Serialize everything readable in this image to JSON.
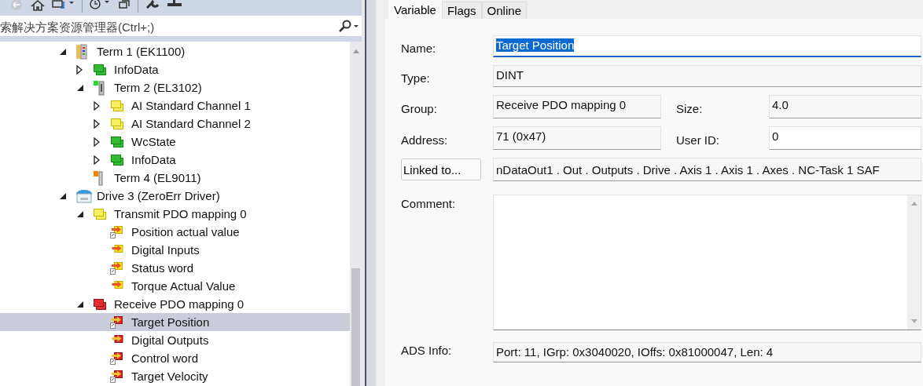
{
  "toolbar": {
    "search": {
      "placeholder": "索解决方案资源管理器(Ctrl+;)"
    }
  },
  "tree": [
    {
      "label": "Term 1 (EK1100)",
      "kind": "coupler",
      "expanded": true,
      "selected": false,
      "children": [
        {
          "label": "InfoData",
          "kind": "green-group",
          "expanded": false,
          "selected": false
        },
        {
          "label": "Term 2 (EL3102)",
          "kind": "terminal",
          "expanded": true,
          "selected": false,
          "children": [
            {
              "label": "AI Standard Channel 1",
              "kind": "yellow-group",
              "expanded": false,
              "selected": false
            },
            {
              "label": "AI Standard Channel 2",
              "kind": "yellow-group",
              "expanded": false,
              "selected": false
            },
            {
              "label": "WcState",
              "kind": "green-group",
              "expanded": false,
              "selected": false
            },
            {
              "label": "InfoData",
              "kind": "green-group",
              "expanded": false,
              "selected": false
            }
          ]
        },
        {
          "label": "Term 4 (EL9011)",
          "kind": "end-terminal",
          "selected": false
        }
      ]
    },
    {
      "label": "Drive 3 (ZeroErr Driver)",
      "kind": "drive",
      "expanded": true,
      "selected": false,
      "children": [
        {
          "label": "Transmit PDO mapping 0",
          "kind": "yellow-group",
          "expanded": true,
          "selected": false,
          "children": [
            {
              "label": "Position actual value",
              "kind": "input-var",
              "linked": true,
              "selected": false
            },
            {
              "label": "Digital Inputs",
              "kind": "input-var",
              "linked": false,
              "selected": false
            },
            {
              "label": "Status word",
              "kind": "input-var",
              "linked": true,
              "selected": false
            },
            {
              "label": "Torque Actual Value",
              "kind": "input-var",
              "linked": false,
              "selected": false
            }
          ]
        },
        {
          "label": "Receive PDO mapping 0",
          "kind": "red-group",
          "expanded": true,
          "selected": false,
          "children": [
            {
              "label": "Target Position",
              "kind": "output-var",
              "linked": true,
              "selected": true
            },
            {
              "label": "Digital Outputs",
              "kind": "output-var",
              "linked": false,
              "selected": false
            },
            {
              "label": "Control word",
              "kind": "output-var",
              "linked": true,
              "selected": false
            },
            {
              "label": "Target Velocity",
              "kind": "output-var",
              "linked": true,
              "selected": false
            }
          ]
        }
      ]
    }
  ],
  "tabs": [
    {
      "label": "Variable",
      "selected": true
    },
    {
      "label": "Flags",
      "selected": false
    },
    {
      "label": "Online",
      "selected": false
    }
  ],
  "form": {
    "name": {
      "label": "Name:",
      "value": "Target Position",
      "text_selected": true
    },
    "type": {
      "label": "Type:",
      "value": "DINT"
    },
    "group": {
      "label": "Group:",
      "value": "Receive PDO mapping 0"
    },
    "size": {
      "label": "Size:",
      "value": "4.0"
    },
    "address": {
      "label": "Address:",
      "value": "71 (0x47)"
    },
    "user_id": {
      "label": "User ID:",
      "value": "0"
    },
    "linked_button": "Linked to...",
    "linked_value": "nDataOut1 . Out . Outputs . Drive . Axis 1 . Axis 1 . Axes . NC-Task 1 SAF",
    "comment": {
      "label": "Comment:"
    },
    "ads_info": {
      "label": "ADS Info:",
      "value": "Port: 11, IGrp: 0x3040020, IOffs: 0x81000047, Len: 4"
    }
  }
}
